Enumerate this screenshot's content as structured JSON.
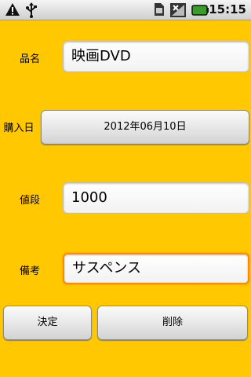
{
  "status_bar": {
    "time": "15:15"
  },
  "form": {
    "name_label": "品名",
    "name_value": "映画DVD",
    "date_label": "購入日",
    "date_value": "2012年06月10日",
    "price_label": "値段",
    "price_value": "1000",
    "note_label": "備考",
    "note_value": "サスペンス"
  },
  "buttons": {
    "ok": "決定",
    "delete": "削除"
  },
  "colors": {
    "background": "#ffc800",
    "focus": "#ff8a00"
  },
  "icons": [
    "warning-icon",
    "usb-icon",
    "sim-icon",
    "signal-icon",
    "battery-icon"
  ]
}
